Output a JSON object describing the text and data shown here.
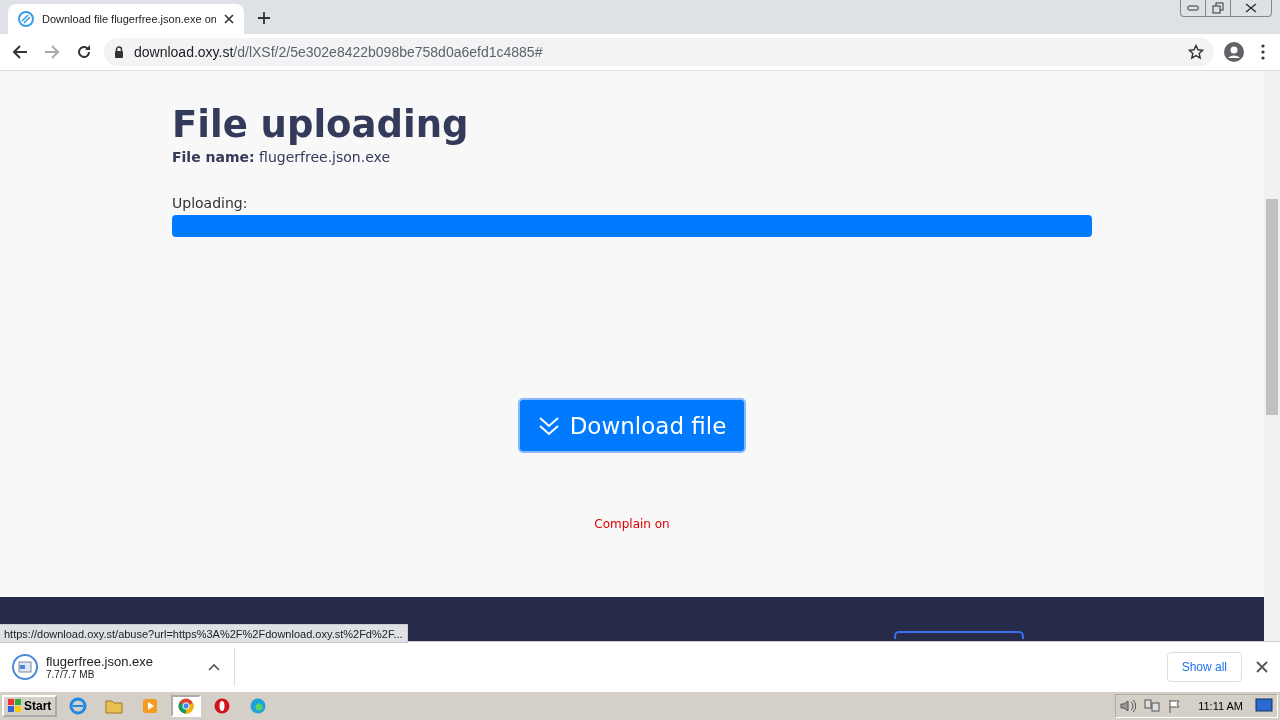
{
  "browser": {
    "tabs": [
      {
        "title": "Download file flugerfree.json.exe on",
        "selected": true
      }
    ],
    "address": {
      "host": "download.oxy.st",
      "path": "/d/lXSf/2/5e302e8422b098be758d0a6efd1c4885#"
    }
  },
  "page": {
    "heading": "File uploading",
    "file_line": "**File name:** flugerfree.json.exe",
    "progress": {
      "label": "Uploading:",
      "level": 1
    },
    "download_button": "Download file",
    "complain_link": "Complain on"
  },
  "status_url": "https://download.oxy.st/abuse?url=https%3A%2F%2Fdownload.oxy.st%2Fd%2F...",
  "download_shelf": {
    "items": [
      {
        "name": "flugerfree.json.exe",
        "size": "7.7/7.7 MB"
      }
    ],
    "show_all": "Show all"
  },
  "taskbar": {
    "start": "Start",
    "apps": [
      {
        "kind": "ie",
        "selected": false
      },
      {
        "kind": "explorer",
        "selected": false
      },
      {
        "kind": "media",
        "selected": false
      },
      {
        "kind": "chrome",
        "selected": true
      },
      {
        "kind": "opera",
        "selected": false
      },
      {
        "kind": "edge",
        "selected": false
      }
    ],
    "clock": "11:11 AM"
  }
}
